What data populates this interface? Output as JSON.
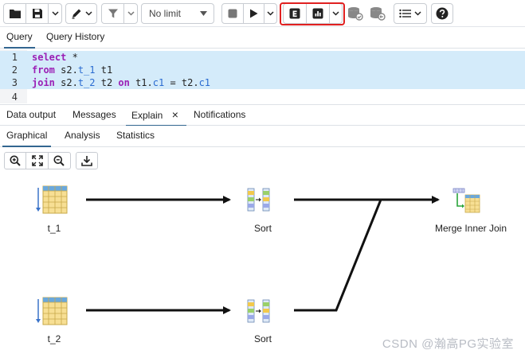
{
  "toolbar": {
    "open_file_icon": "folder-icon",
    "save_icon": "floppy-disk-icon",
    "edit_icon": "pencil-icon",
    "filter_icon": "funnel-icon",
    "limit_value": "No limit",
    "stop_icon": "stop-square-icon",
    "execute_icon": "play-icon",
    "explain_icon": "explain-e-icon",
    "explain_analyze_icon": "bar-chart-icon",
    "commit_icon": "database-check-icon",
    "rollback_icon": "database-undo-icon",
    "macros_icon": "list-icon",
    "help_icon": "help-circle-icon",
    "highlight_color": "#e02020"
  },
  "editor_tabs": [
    "Query",
    "Query History"
  ],
  "editor": {
    "line_numbers": [
      "1",
      "2",
      "3",
      "4"
    ]
  },
  "result_tabs": [
    "Data output",
    "Messages",
    "Explain",
    "Notifications"
  ],
  "explain_close": "×",
  "explain_subtabs": [
    "Graphical",
    "Analysis",
    "Statistics"
  ],
  "plan_nodes": {
    "t1": "t_1",
    "t2": "t_2",
    "sort1": "Sort",
    "sort2": "Sort",
    "merge": "Merge Inner Join"
  },
  "watermark": "CSDN @瀚高PG实验室",
  "colors": {
    "accent": "#326690",
    "keyword": "#9b1fb5",
    "identifier": "#2a6bd1",
    "selection": "#d4ebfa"
  }
}
